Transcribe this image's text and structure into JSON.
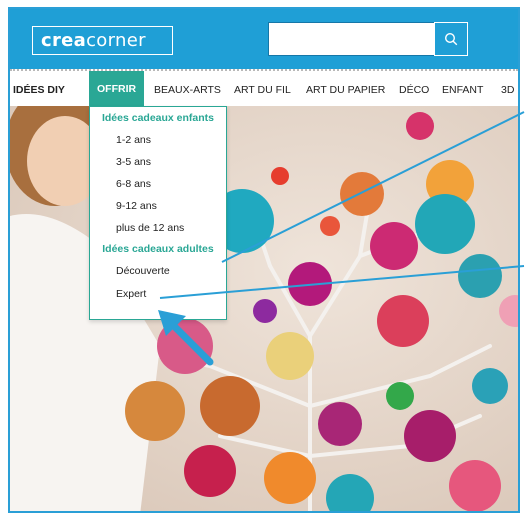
{
  "logo": {
    "bold": "crea",
    "light": "corner"
  },
  "search": {
    "value": "",
    "placeholder": ""
  },
  "nav": {
    "items": [
      "IDÉES DIY",
      "OFFRIR",
      "BEAUX-ARTS",
      "ART DU FIL",
      "ART DU PAPIER",
      "DÉCO",
      "ENFANT",
      "3D"
    ],
    "active": "OFFRIR"
  },
  "dropdown": {
    "children_heading": "Idées cadeaux enfants",
    "children_items": [
      "1-2 ans",
      "3-5 ans",
      "6-8 ans",
      "9-12 ans",
      "plus de 12 ans"
    ],
    "adults_heading": "Idées cadeaux adultes",
    "adults_items": [
      "Découverte",
      "Expert"
    ]
  },
  "colors": {
    "brand_blue": "#1f9fd6",
    "teal": "#2aa795",
    "annotation_arrow": "#2a9fd6"
  },
  "icons": {
    "search": "search-icon"
  }
}
